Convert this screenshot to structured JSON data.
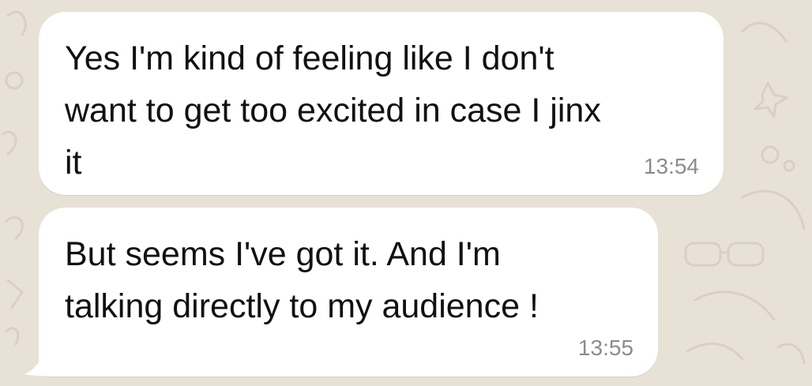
{
  "chat": {
    "messages": [
      {
        "text": "Yes I'm kind of feeling like I don't\nwant to get too excited in case I jinx\nit",
        "time": "13:54"
      },
      {
        "text": "But seems I've got it. And I'm\ntalking directly to my audience !",
        "time": "13:55"
      }
    ]
  }
}
